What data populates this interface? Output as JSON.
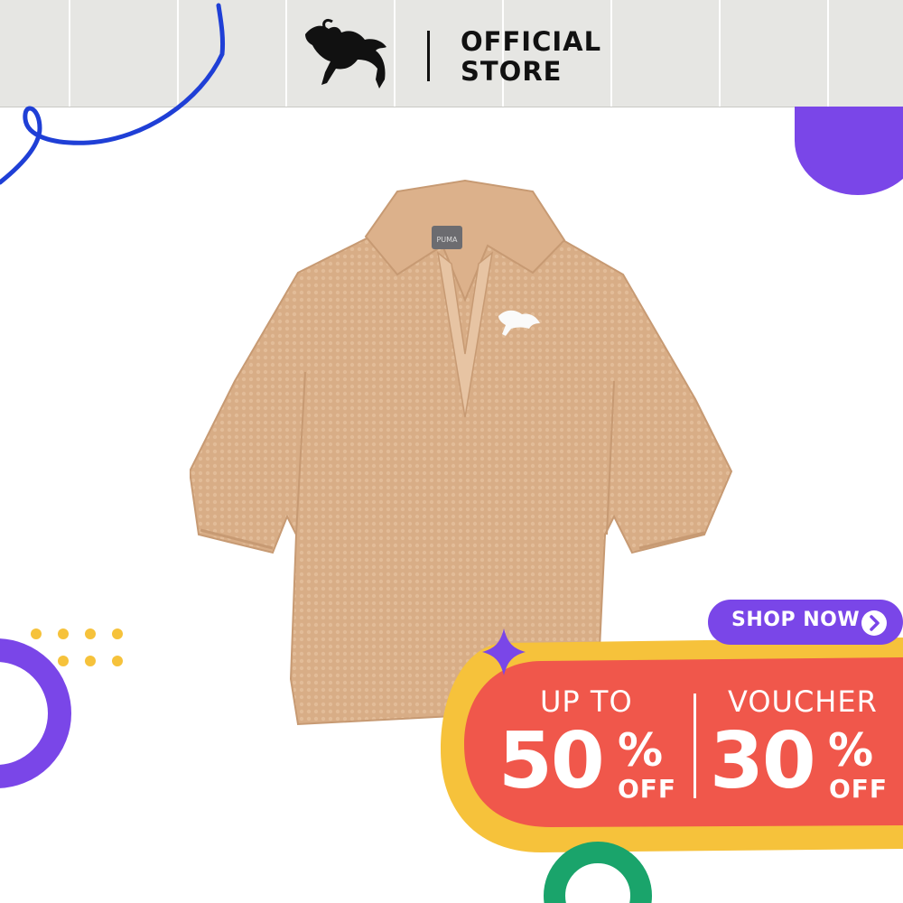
{
  "header": {
    "brand_logo": "puma-cat-logo",
    "store_label_line1": "OFFICIAL",
    "store_label_line2": "STORE"
  },
  "product": {
    "image": "beige-short-sleeve-polo-shirt",
    "icon": "shirt-icon"
  },
  "promo": {
    "shop_now_label": "SHOP NOW",
    "left_caption": "UP TO",
    "left_value": "50",
    "left_percent": "%",
    "left_suffix": "OFF",
    "right_caption": "VOUCHER",
    "right_value": "30",
    "right_percent": "%",
    "right_suffix": "OFF"
  },
  "colors": {
    "header_bg": "#e6e6e3",
    "promo_red": "#f0574b",
    "promo_yellow": "#f6c23b",
    "accent_purple": "#7a46e8",
    "accent_blue": "#1f3fd6",
    "accent_green": "#1aa46b",
    "shirt_beige": "#d8ad86"
  }
}
